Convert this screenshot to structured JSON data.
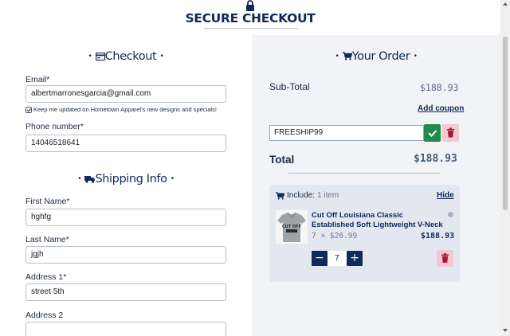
{
  "header": {
    "title": "SECURE CHECKOUT",
    "icon": "lock-icon"
  },
  "checkout": {
    "heading": "Checkout",
    "heading_icon": "credit-card-icon",
    "email_label": "Email*",
    "email_value": "albertmarronesgarcia@gmail.com",
    "newsletter_label": "Keep me updated on Hometown Apparel's new designs and specials!",
    "newsletter_checked": true,
    "phone_label": "Phone number*",
    "phone_value": "14046518641"
  },
  "shipping": {
    "heading": "Shipping Info",
    "heading_icon": "truck-icon",
    "first_name_label": "First Name*",
    "first_name_value": "hghfg",
    "last_name_label": "Last Name*",
    "last_name_value": "jgjh",
    "address1_label": "Address 1*",
    "address1_value": "street 5th",
    "address2_label": "Address 2",
    "address2_value": ""
  },
  "order": {
    "heading": "Your Order",
    "heading_icon": "cart-icon",
    "subtotal_label": "Sub-Total",
    "subtotal_value": "$188.93",
    "add_coupon": "Add coupon",
    "coupon_code": "FREESHIP99",
    "total_label": "Total",
    "total_value": "$188.93",
    "include_label": "Include:",
    "include_count": "1 item",
    "hide_link": "Hide",
    "item": {
      "name": "Cut Off Louisiana Classic Established Soft Lightweight V-Neck",
      "qty_price": "7 × $26.99",
      "line_total": "$188.93",
      "quantity": "7",
      "thumb_text": "CUT OFF"
    }
  },
  "colors": {
    "primary": "#0f2a5c",
    "confirm": "#1f8a4c",
    "delete_bg": "#f0c9d2",
    "delete_icon": "#b0133a"
  }
}
